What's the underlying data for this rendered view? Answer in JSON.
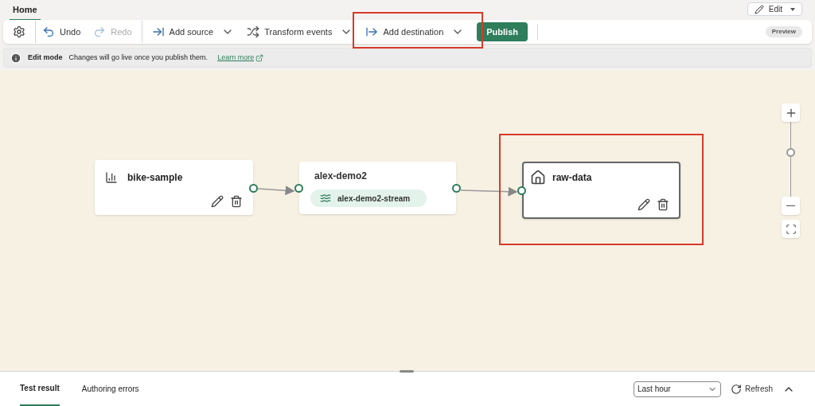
{
  "ribbon_tabs": [
    {
      "label": "Home",
      "selected": true
    }
  ],
  "edit_button": {
    "label": "Edit"
  },
  "toolbar": {
    "items": [
      {
        "kind": "settings"
      },
      {
        "kind": "undo",
        "label": "Undo",
        "disabled": false
      },
      {
        "kind": "redo",
        "label": "Redo",
        "disabled": true
      },
      {
        "kind": "add-source",
        "label": "Add source",
        "highlighted": false
      },
      {
        "kind": "transform",
        "label": "Transform events",
        "highlighted": false
      },
      {
        "kind": "add-destination",
        "label": "Add destination",
        "highlighted": true
      },
      {
        "kind": "publish",
        "label": "Publish"
      }
    ],
    "badge": "Preview"
  },
  "info_bar": {
    "title": "Edit mode",
    "message": "Changes will go live once you publish them.",
    "link": "Learn more"
  },
  "canvas": {
    "nodes": [
      {
        "kind": "source",
        "title": "bike-sample",
        "selected": false,
        "highlighted": false
      },
      {
        "kind": "stream",
        "title": "alex-demo2",
        "chip": "alex-demo2-stream",
        "selected": false,
        "highlighted": false
      },
      {
        "kind": "destination",
        "title": "raw-data",
        "selected": true,
        "highlighted": true
      }
    ],
    "zoom": {
      "level": 0.6
    }
  },
  "bottom_panel": {
    "tabs": [
      {
        "label": "Test result",
        "selected": true
      },
      {
        "label": "Authoring errors",
        "selected": false
      }
    ],
    "time_range": "Last hour",
    "refresh": "Refresh"
  }
}
